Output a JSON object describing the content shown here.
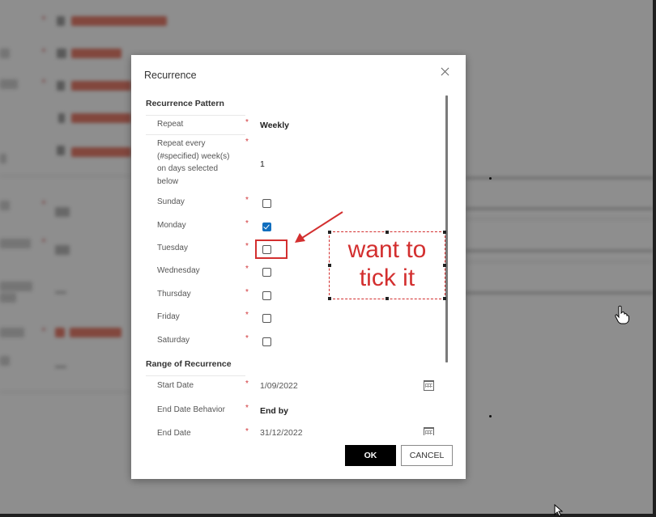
{
  "dialog": {
    "title": "Recurrence",
    "sections": {
      "pattern": "Recurrence Pattern",
      "range": "Range of Recurrence"
    },
    "fields": {
      "repeat": {
        "label": "Repeat",
        "value": "Weekly"
      },
      "repeat_every": {
        "label": "Repeat every (#specified) week(s) on days selected below",
        "value": "1"
      },
      "sunday": {
        "label": "Sunday",
        "checked": false
      },
      "monday": {
        "label": "Monday",
        "checked": true
      },
      "tuesday": {
        "label": "Tuesday",
        "checked": false
      },
      "wednesday": {
        "label": "Wednesday",
        "checked": false
      },
      "thursday": {
        "label": "Thursday",
        "checked": false
      },
      "friday": {
        "label": "Friday",
        "checked": false
      },
      "saturday": {
        "label": "Saturday",
        "checked": false
      },
      "start_date": {
        "label": "Start Date",
        "value": "1/09/2022"
      },
      "end_date_behavior": {
        "label": "End Date Behavior",
        "value": "End by"
      },
      "end_date": {
        "label": "End Date",
        "value": "31/12/2022"
      }
    },
    "required_marker": "*",
    "buttons": {
      "ok": "OK",
      "cancel": "CANCEL"
    }
  },
  "annotation": {
    "text_line1": "want to",
    "text_line2": "tick it",
    "color": "#d32f2f"
  },
  "colors": {
    "required": "#d13438",
    "checkbox_checked": "#106ebe",
    "ok_button": "#000000"
  }
}
